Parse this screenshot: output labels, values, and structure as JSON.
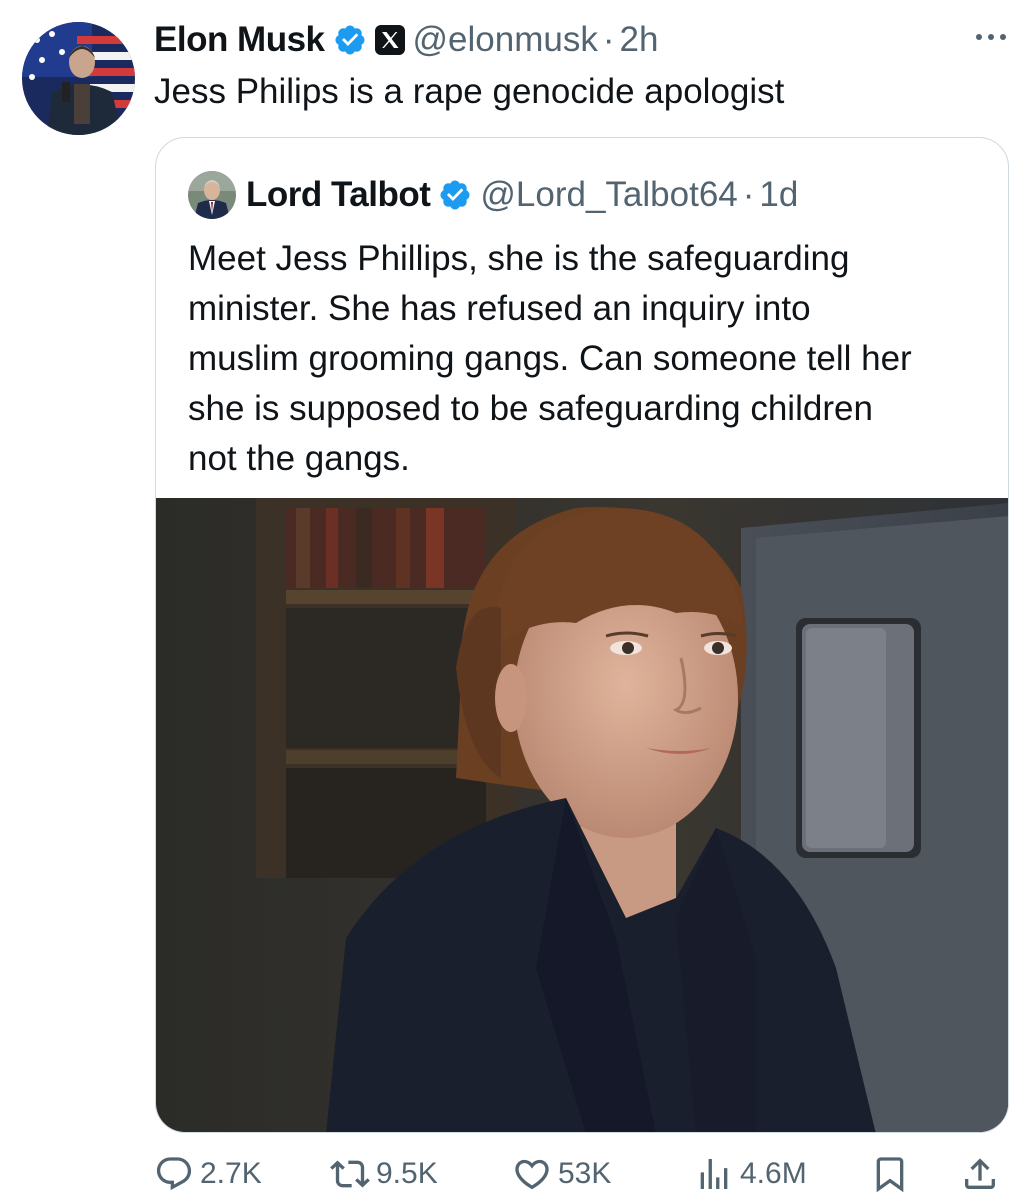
{
  "post": {
    "author_name": "Elon Musk",
    "handle": "@elonmusk",
    "separator": "·",
    "time": "2h",
    "text": "Jess Philips is a rape genocide apologist"
  },
  "quoted": {
    "author_name": "Lord Talbot",
    "handle": "@Lord_Talbot64",
    "separator": "·",
    "time": "1d",
    "text": "Meet Jess Phillips, she is the safeguarding\nminister. She has refused an inquiry into\nmuslim grooming gangs. Can someone tell her\nshe is supposed to be safeguarding children\nnot the gangs."
  },
  "actions": {
    "reply_count": "2.7K",
    "repost_count": "9.5K",
    "like_count": "53K",
    "view_count": "4.6M"
  },
  "icons": [
    "verified-icon",
    "x-logo-icon",
    "more-icon",
    "reply-icon",
    "repost-icon",
    "like-icon",
    "views-icon",
    "bookmark-icon",
    "share-icon"
  ],
  "colors": {
    "verified": "#1d9bf0",
    "secondary_text": "#536471",
    "border": "#cfd9de"
  }
}
